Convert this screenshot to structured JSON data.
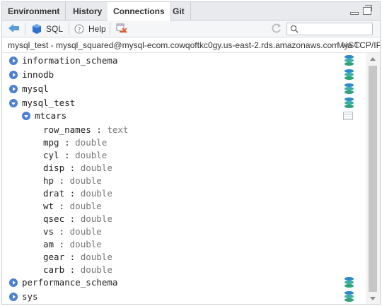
{
  "tabs": [
    {
      "label": "Environment",
      "active": false
    },
    {
      "label": "History",
      "active": false
    },
    {
      "label": "Connections",
      "active": true
    },
    {
      "label": "Git",
      "active": false
    }
  ],
  "toolbar": {
    "back_icon": "left-arrow-icon",
    "sql_label": "SQL",
    "help_label": "Help",
    "search_placeholder": ""
  },
  "connection_info": {
    "text": "mysql_test - mysql_squared@mysql-ecom.cowqoftkc0gy.us-east-2.rds.amazonaws.com via TCP/IP",
    "overflow": "MySC"
  },
  "tree": {
    "schemas_top": [
      {
        "name": "information_schema"
      },
      {
        "name": "innodb"
      },
      {
        "name": "mysql"
      }
    ],
    "open_schema": {
      "name": "mysql_test"
    },
    "table": {
      "name": "mtcars",
      "fields": [
        {
          "name": "row_names",
          "type": "text"
        },
        {
          "name": "mpg",
          "type": "double"
        },
        {
          "name": "cyl",
          "type": "double"
        },
        {
          "name": "disp",
          "type": "double"
        },
        {
          "name": "hp",
          "type": "double"
        },
        {
          "name": "drat",
          "type": "double"
        },
        {
          "name": "wt",
          "type": "double"
        },
        {
          "name": "qsec",
          "type": "double"
        },
        {
          "name": "vs",
          "type": "double"
        },
        {
          "name": "am",
          "type": "double"
        },
        {
          "name": "gear",
          "type": "double"
        },
        {
          "name": "carb",
          "type": "double"
        }
      ]
    },
    "schemas_bottom": [
      {
        "name": "performance_schema"
      },
      {
        "name": "sys"
      }
    ]
  },
  "colors": {
    "expander": "#4b7fd1",
    "db_icon_top": "#2e8bc9",
    "db_icon_mid": "#3bb0a6",
    "db_icon_low": "#2ea37a"
  }
}
